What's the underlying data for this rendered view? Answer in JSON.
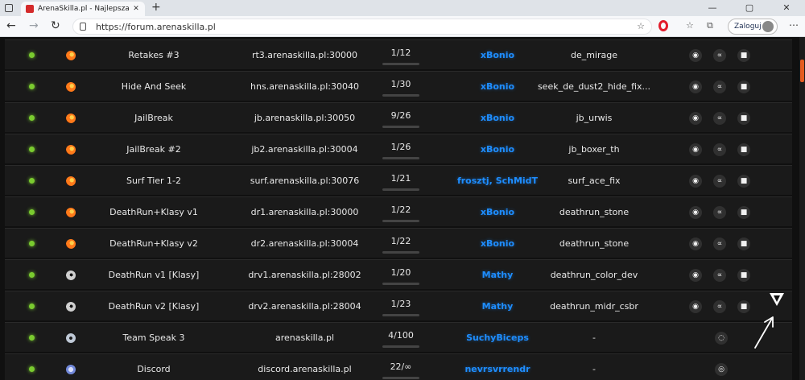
{
  "browser": {
    "tab_title": "ArenaSkilla.pl - Najlepsza Sieć S",
    "url": "https://forum.arenaskilla.pl",
    "login_label": "Zaloguj",
    "new_tab_symbol": "+",
    "back_symbol": "←",
    "forward_symbol": "→",
    "refresh_symbol": "↻",
    "min_symbol": "—",
    "max_symbol": "▢",
    "close_symbol": "✕",
    "more_symbol": "⋯",
    "tab_close_symbol": "✕"
  },
  "servers": [
    {
      "name": "Retakes #3",
      "address": "rt3.arenaskilla.pl:30000",
      "players": "1/12",
      "fill": 0.08,
      "admin": "xBonio",
      "map": "de_mirage",
      "game": "csgo"
    },
    {
      "name": "Hide And Seek",
      "address": "hns.arenaskilla.pl:30040",
      "players": "1/30",
      "fill": 0.03,
      "admin": "xBonio",
      "map": "seek_de_dust2_hide_fix...",
      "game": "csgo"
    },
    {
      "name": "JailBreak",
      "address": "jb.arenaskilla.pl:30050",
      "players": "9/26",
      "fill": 0.35,
      "admin": "xBonio",
      "map": "jb_urwis",
      "game": "csgo"
    },
    {
      "name": "JailBreak #2",
      "address": "jb2.arenaskilla.pl:30004",
      "players": "1/26",
      "fill": 0.04,
      "admin": "xBonio",
      "map": "jb_boxer_th",
      "game": "csgo"
    },
    {
      "name": "Surf Tier 1-2",
      "address": "surf.arenaskilla.pl:30076",
      "players": "1/21",
      "fill": 0.05,
      "admin": "frosztj, SchMidT",
      "map": "surf_ace_fix",
      "game": "csgo"
    },
    {
      "name": "DeathRun+Klasy v1",
      "address": "dr1.arenaskilla.pl:30000",
      "players": "1/22",
      "fill": 0.05,
      "admin": "xBonio",
      "map": "deathrun_stone",
      "game": "csgo"
    },
    {
      "name": "DeathRun+Klasy v2",
      "address": "dr2.arenaskilla.pl:30004",
      "players": "1/22",
      "fill": 0.05,
      "admin": "xBonio",
      "map": "deathrun_stone",
      "game": "csgo"
    },
    {
      "name": "DeathRun v1 [Klasy]",
      "address": "drv1.arenaskilla.pl:28002",
      "players": "1/20",
      "fill": 0.05,
      "admin": "Mathy",
      "map": "deathrun_color_dev",
      "game": "cs16"
    },
    {
      "name": "DeathRun v2 [Klasy]",
      "address": "drv2.arenaskilla.pl:28004",
      "players": "1/23",
      "fill": 0.04,
      "admin": "Mathy",
      "map": "deathrun_midr_csbr",
      "game": "cs16"
    },
    {
      "name": "Team Speak 3",
      "address": "arenaskilla.pl",
      "players": "4/100",
      "fill": 0.04,
      "admin": "SuchyBiceps",
      "map": "-",
      "game": "teamspeak"
    },
    {
      "name": "Discord",
      "address": "discord.arenaskilla.pl",
      "players": "22/∞",
      "fill": 0.2,
      "admin": "nevrsvrrendr",
      "map": "-",
      "game": "discord"
    }
  ],
  "icons": {
    "steam": "◉",
    "join": "∝",
    "video": "■",
    "teamspeak": "◌",
    "discord": "◎"
  }
}
